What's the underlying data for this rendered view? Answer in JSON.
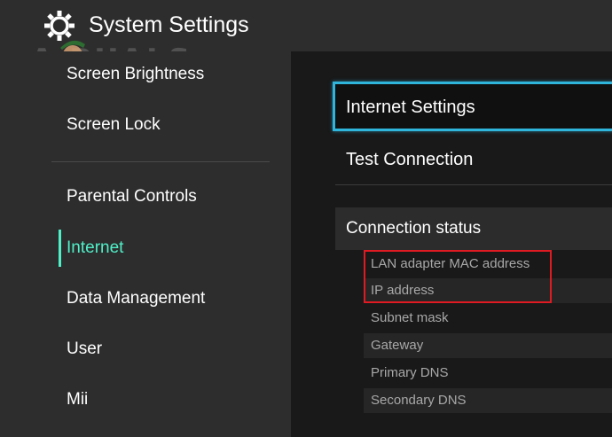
{
  "header": {
    "title": "System Settings",
    "icon": "gear-icon"
  },
  "watermark": {
    "text": "A  PUALS"
  },
  "sidebar": {
    "items": [
      {
        "label": "Screen Brightness",
        "active": false
      },
      {
        "label": "Screen Lock",
        "active": false
      },
      {
        "label": "Parental Controls",
        "active": false
      },
      {
        "label": "Internet",
        "active": true
      },
      {
        "label": "Data Management",
        "active": false
      },
      {
        "label": "User",
        "active": false
      },
      {
        "label": "Mii",
        "active": false
      }
    ]
  },
  "main": {
    "internet_settings_label": "Internet Settings",
    "test_connection_label": "Test Connection",
    "connection_status": {
      "title": "Connection status",
      "rows": [
        {
          "label": "LAN adapter MAC address"
        },
        {
          "label": "IP address"
        },
        {
          "label": "Subnet mask"
        },
        {
          "label": "Gateway"
        },
        {
          "label": "Primary DNS"
        },
        {
          "label": "Secondary DNS"
        }
      ]
    }
  },
  "colors": {
    "accent": "#4ff0c8",
    "focus_border": "#2fb4dc",
    "highlight_box": "#e01a22",
    "background": "#2d2d2d",
    "panel": "#191919"
  }
}
